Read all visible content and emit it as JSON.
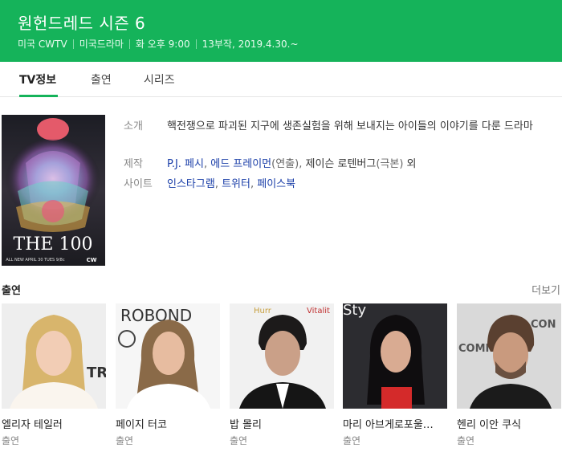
{
  "header": {
    "title": "원헌드레드 시즌 6",
    "meta": [
      "미국 CWTV",
      "미국드라마",
      "화 오후 9:00",
      "13부작, 2019.4.30.~"
    ]
  },
  "tabs": [
    {
      "label": "TV정보",
      "active": true
    },
    {
      "label": "출연",
      "active": false
    },
    {
      "label": "시리즈",
      "active": false
    }
  ],
  "poster": {
    "title_mark": "THE 100",
    "caption": "ALL NEW APRIL 30 TUES 9/8c",
    "network": "CW"
  },
  "info": {
    "intro": {
      "label": "소개",
      "text": "핵전쟁으로 파괴된 지구에 생존실험을 위해 보내지는 아이들의 이야기를 다룬 드라마"
    },
    "production": {
      "label": "제작",
      "links": [
        "P.J. 페시",
        "에드 프레이먼"
      ],
      "role1": "(연출)",
      "writer": "제이슨 로텐버그",
      "role2": "(극본)",
      "suffix": " 외"
    },
    "site": {
      "label": "사이트",
      "links": [
        "인스타그램",
        "트위터",
        "페이스북"
      ]
    }
  },
  "cast": {
    "heading": "출연",
    "more": "더보기",
    "members": [
      {
        "name": "엘리자 테일러",
        "role": "출연"
      },
      {
        "name": "페이지 터코",
        "role": "출연"
      },
      {
        "name": "밥 몰리",
        "role": "출연"
      },
      {
        "name": "마리 아브게로포울…",
        "role": "출연"
      },
      {
        "name": "헨리 이안 쿠식",
        "role": "출연"
      }
    ]
  },
  "colors": {
    "accent": "#15b35a",
    "link": "#1a3ea8"
  }
}
